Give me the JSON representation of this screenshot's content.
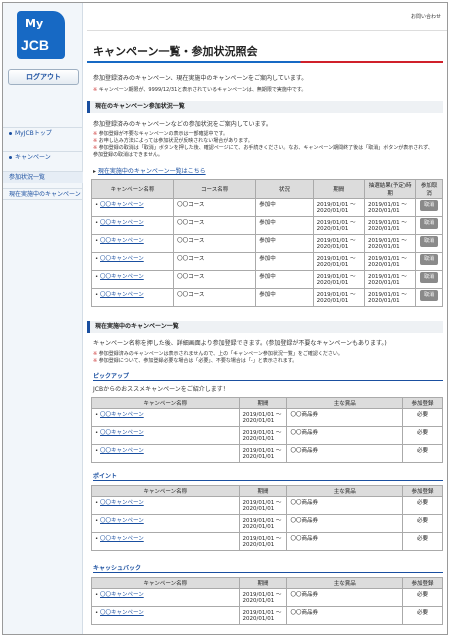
{
  "brand": {
    "my": "My",
    "jcb": "JCB"
  },
  "side": {
    "logout": "ログアウト",
    "nav": [
      "MyJCBトップ",
      "キャンペーン",
      "参加状況一覧",
      "現在実施中のキャンペーン"
    ]
  },
  "header": {
    "help": "お問い合わせ"
  },
  "page": {
    "title": "キャンペーン一覧・参加状況照会",
    "intro": "参加登録済みのキャンペーン、現在実施中のキャンペーンをご案内しています。",
    "intro_note": "キャンペーン期限が、9999/12/31と表示されているキャンペーンは、無期限で実施中です。"
  },
  "sec1": {
    "title": "現在のキャンペーン参加状況一覧",
    "lead": "参加登録済みのキャンペーンなどの参加状況をご案内しています。",
    "notes": [
      "参加登録が不要なキャンペーンの表示は一部確認中です。",
      "お申し込み方法によっては参加状況が反映されない場合があります。",
      "参加登録の取消は「取消」ボタンを押した後、確認ページにて、お手続きください。なお、キャンペーン期間終了後は「取消」ボタンが表示されず、参加登録の取消はできません。"
    ],
    "link": "現在実施中のキャンペーン一覧はこちら",
    "headers": [
      "キャンペーン名称",
      "コース名称",
      "状況",
      "期間",
      "抽選結果(予定)時期",
      "参加取消"
    ],
    "rows": [
      {
        "name": "〇〇キャンペーン",
        "course": "〇〇コース",
        "status": "参加中",
        "period": "2019/01/01 〜 2020/01/01",
        "draw": "2019/01/01 〜 2020/01/01",
        "cancel": "取消"
      },
      {
        "name": "〇〇キャンペーン",
        "course": "〇〇コース",
        "status": "参加中",
        "period": "2019/01/01 〜 2020/01/01",
        "draw": "2019/01/01 〜 2020/01/01",
        "cancel": "取消"
      },
      {
        "name": "〇〇キャンペーン",
        "course": "〇〇コース",
        "status": "参加中",
        "period": "2019/01/01 〜 2020/01/01",
        "draw": "2019/01/01 〜 2020/01/01",
        "cancel": "取消"
      },
      {
        "name": "〇〇キャンペーン",
        "course": "〇〇コース",
        "status": "参加中",
        "period": "2019/01/01 〜 2020/01/01",
        "draw": "2019/01/01 〜 2020/01/01",
        "cancel": "取消"
      },
      {
        "name": "〇〇キャンペーン",
        "course": "〇〇コース",
        "status": "参加中",
        "period": "2019/01/01 〜 2020/01/01",
        "draw": "2019/01/01 〜 2020/01/01",
        "cancel": "取消"
      },
      {
        "name": "〇〇キャンペーン",
        "course": "〇〇コース",
        "status": "参加中",
        "period": "2019/01/01 〜 2020/01/01",
        "draw": "2019/01/01 〜 2020/01/01",
        "cancel": "取消"
      }
    ]
  },
  "sec2": {
    "title": "現在実施中のキャンペーン一覧",
    "lead": "キャンペーン名称を押した後、詳細画面より参加登録できます。(参加登録が不要なキャンペーンもあります。)",
    "notes": [
      "参加登録済みのキャンペーンは表示されませんので、上の「キャンペーン参加状況一覧」をご確認ください。",
      "参加登録について、参加登録必要な場合は「必要」、不要な場合は「-」と表示されます。"
    ]
  },
  "pickup": {
    "title": "ピックアップ",
    "lead": "JCBからのおススメキャンペーンをご紹介します！",
    "headers": [
      "キャンペーン名称",
      "期間",
      "主な賞品",
      "参加登録"
    ],
    "rows": [
      {
        "name": "〇〇キャンペーン",
        "period": "2019/01/01 〜 2020/01/01",
        "prize": "〇〇商品券",
        "reg": "必要"
      },
      {
        "name": "〇〇キャンペーン",
        "period": "2019/01/01 〜 2020/01/01",
        "prize": "〇〇商品券",
        "reg": "必要"
      },
      {
        "name": "〇〇キャンペーン",
        "period": "2019/01/01 〜 2020/01/01",
        "prize": "〇〇商品券",
        "reg": "必要"
      }
    ]
  },
  "point": {
    "title": "ポイント",
    "headers": [
      "キャンペーン名称",
      "期間",
      "主な賞品",
      "参加登録"
    ],
    "rows": [
      {
        "name": "〇〇キャンペーン",
        "period": "2019/01/01 〜 2020/01/01",
        "prize": "〇〇商品券",
        "reg": "必要"
      },
      {
        "name": "〇〇キャンペーン",
        "period": "2019/01/01 〜 2020/01/01",
        "prize": "〇〇商品券",
        "reg": "必要"
      },
      {
        "name": "〇〇キャンペーン",
        "period": "2019/01/01 〜 2020/01/01",
        "prize": "〇〇商品券",
        "reg": "必要"
      }
    ]
  },
  "cashback": {
    "title": "キャッシュバック",
    "headers": [
      "キャンペーン名称",
      "期間",
      "主な賞品",
      "参加登録"
    ],
    "rows": [
      {
        "name": "〇〇キャンペーン",
        "period": "2019/01/01 〜 2020/01/01",
        "prize": "〇〇商品券",
        "reg": "必要"
      },
      {
        "name": "〇〇キャンペーン",
        "period": "2019/01/01 〜 2020/01/01",
        "prize": "〇〇商品券",
        "reg": "必要"
      }
    ]
  },
  "colors": {
    "accent": "#1a4fa0",
    "brand": "#1769c4",
    "red": "#d0202a"
  }
}
